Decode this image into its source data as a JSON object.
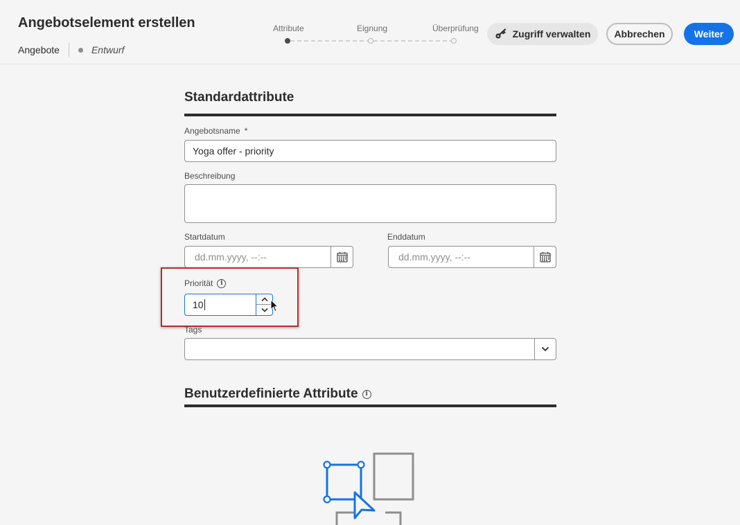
{
  "header": {
    "title": "Angebotselement erstellen",
    "breadcrumb": "Angebote",
    "status": "Entwurf",
    "steps": [
      {
        "label": "Attribute",
        "active": true
      },
      {
        "label": "Eignung",
        "active": false
      },
      {
        "label": "Überprüfung",
        "active": false
      }
    ],
    "access_label": "Zugriff verwalten",
    "cancel_label": "Abbrechen",
    "next_label": "Weiter"
  },
  "standard": {
    "title": "Standardattribute",
    "name_label": "Angebotsname",
    "required_mark": "*",
    "name_value": "Yoga offer - priority",
    "description_label": "Beschreibung",
    "description_value": "",
    "start_label": "Startdatum",
    "start_placeholder": "dd.mm.yyyy, --:--",
    "end_label": "Enddatum",
    "end_placeholder": "dd.mm.yyyy, --:--",
    "priority_label": "Priorität",
    "priority_value": "10",
    "tags_label": "Tags",
    "tags_value": ""
  },
  "custom": {
    "title": "Benutzerdefinierte Attribute"
  },
  "colors": {
    "accent": "#1473e6",
    "highlight": "#c0282a",
    "text": "#2c2c2c"
  },
  "icons": [
    "key-icon",
    "calendar-icon",
    "info-icon",
    "chevron-up-icon",
    "chevron-down-icon",
    "mouse-cursor-icon",
    "empty-state-illustration"
  ]
}
